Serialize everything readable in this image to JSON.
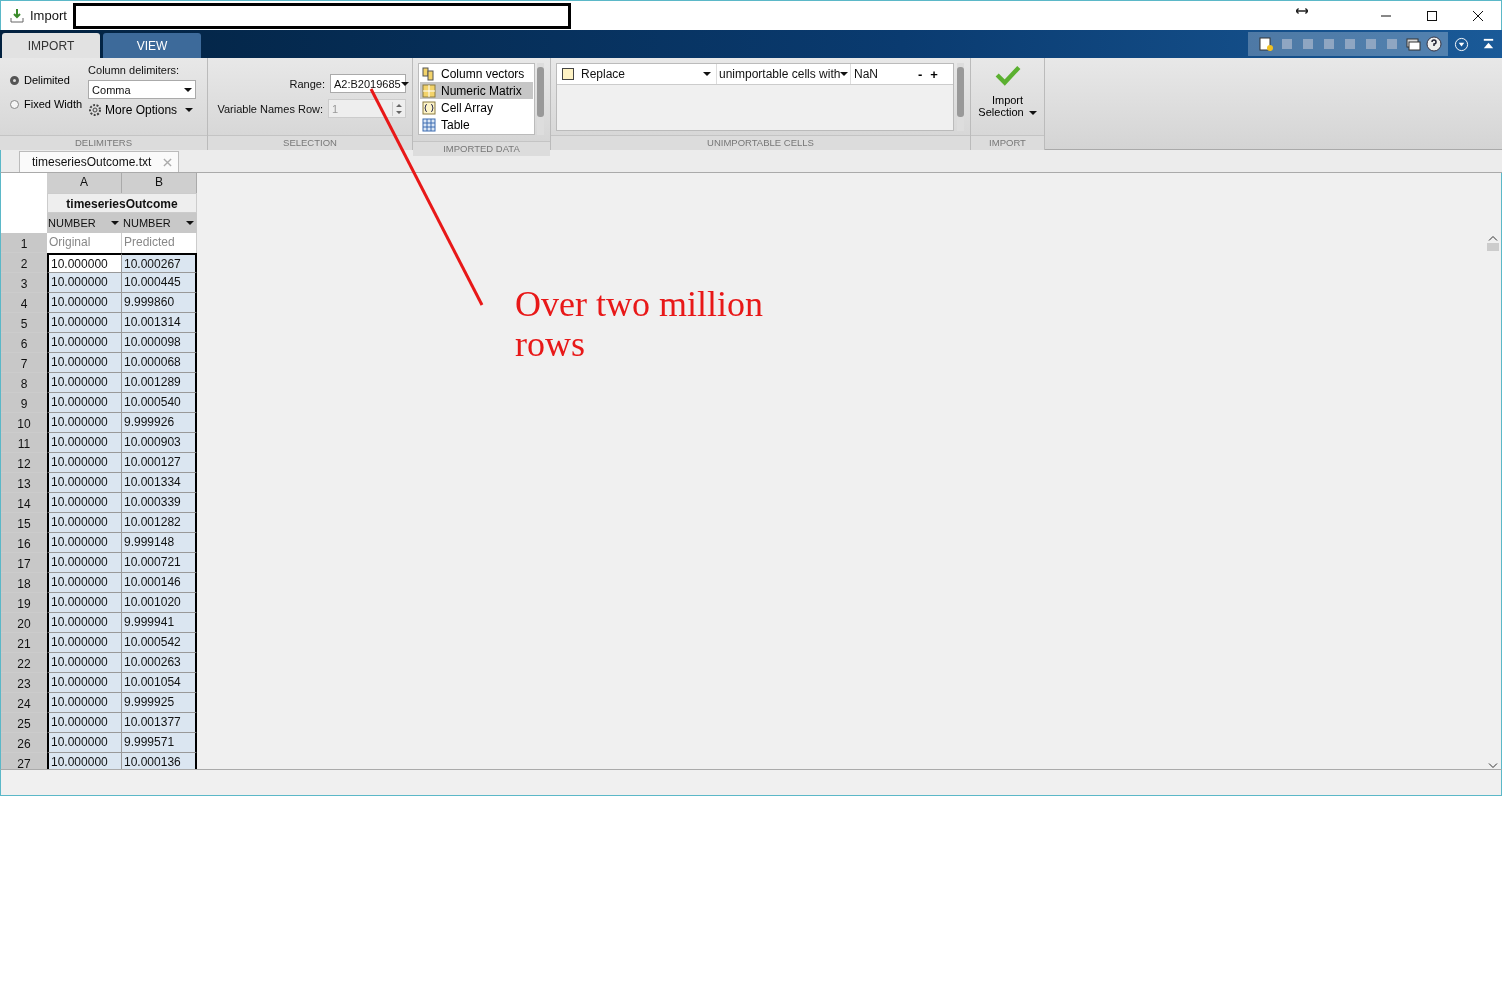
{
  "window": {
    "title": "Import"
  },
  "tabs": [
    {
      "label": "IMPORT",
      "selected": true
    },
    {
      "label": "VIEW",
      "selected": false
    }
  ],
  "delimiters": {
    "options": [
      {
        "label": "Delimited",
        "selected": true
      },
      {
        "label": "Fixed Width",
        "selected": false
      }
    ],
    "label": "Column delimiters:",
    "value": "Comma",
    "more_options": "More Options",
    "section": "DELIMITERS"
  },
  "selection": {
    "range_label": "Range:",
    "range_value": "A2:B2019685",
    "var_row_label": "Variable Names Row:",
    "var_row_value": "1",
    "section": "SELECTION"
  },
  "imported_data": {
    "items": [
      {
        "label": "Column vectors",
        "kind": "vectors",
        "selected": false
      },
      {
        "label": "Numeric Matrix",
        "kind": "matrix",
        "selected": true
      },
      {
        "label": "Cell Array",
        "kind": "cell",
        "selected": false
      },
      {
        "label": "Table",
        "kind": "table",
        "selected": false
      }
    ],
    "section": "IMPORTED DATA"
  },
  "unimportable": {
    "rules": [
      {
        "action": "Replace",
        "condition": "unimportable cells with",
        "value": "NaN",
        "color": "#fff3c4"
      }
    ],
    "minus": "-",
    "plus": "+",
    "section": "UNIMPORTABLE CELLS"
  },
  "import": {
    "button": "Import Selection",
    "section": "IMPORT"
  },
  "doc_tab": "timeseriesOutcome.txt",
  "table": {
    "columns": [
      "A",
      "B"
    ],
    "variable": "timeseriesOutcome",
    "types": [
      "NUMBER",
      "NUMBER"
    ],
    "header_row": {
      "n": "1",
      "cells": [
        "Original",
        "Predicted"
      ]
    },
    "rows": [
      {
        "n": "2",
        "cells": [
          "10.000000",
          "10.000267"
        ],
        "current": true
      },
      {
        "n": "3",
        "cells": [
          "10.000000",
          "10.000445"
        ],
        "current": false
      },
      {
        "n": "4",
        "cells": [
          "10.000000",
          "9.999860"
        ],
        "current": false
      },
      {
        "n": "5",
        "cells": [
          "10.000000",
          "10.001314"
        ],
        "current": false
      },
      {
        "n": "6",
        "cells": [
          "10.000000",
          "10.000098"
        ],
        "current": false
      },
      {
        "n": "7",
        "cells": [
          "10.000000",
          "10.000068"
        ],
        "current": false
      },
      {
        "n": "8",
        "cells": [
          "10.000000",
          "10.001289"
        ],
        "current": false
      },
      {
        "n": "9",
        "cells": [
          "10.000000",
          "10.000540"
        ],
        "current": false
      },
      {
        "n": "10",
        "cells": [
          "10.000000",
          "9.999926"
        ],
        "current": false
      },
      {
        "n": "11",
        "cells": [
          "10.000000",
          "10.000903"
        ],
        "current": false
      },
      {
        "n": "12",
        "cells": [
          "10.000000",
          "10.000127"
        ],
        "current": false
      },
      {
        "n": "13",
        "cells": [
          "10.000000",
          "10.001334"
        ],
        "current": false
      },
      {
        "n": "14",
        "cells": [
          "10.000000",
          "10.000339"
        ],
        "current": false
      },
      {
        "n": "15",
        "cells": [
          "10.000000",
          "10.001282"
        ],
        "current": false
      },
      {
        "n": "16",
        "cells": [
          "10.000000",
          "9.999148"
        ],
        "current": false
      },
      {
        "n": "17",
        "cells": [
          "10.000000",
          "10.000721"
        ],
        "current": false
      },
      {
        "n": "18",
        "cells": [
          "10.000000",
          "10.000146"
        ],
        "current": false
      },
      {
        "n": "19",
        "cells": [
          "10.000000",
          "10.001020"
        ],
        "current": false
      },
      {
        "n": "20",
        "cells": [
          "10.000000",
          "9.999941"
        ],
        "current": false
      },
      {
        "n": "21",
        "cells": [
          "10.000000",
          "10.000542"
        ],
        "current": false
      },
      {
        "n": "22",
        "cells": [
          "10.000000",
          "10.000263"
        ],
        "current": false
      },
      {
        "n": "23",
        "cells": [
          "10.000000",
          "10.001054"
        ],
        "current": false
      },
      {
        "n": "24",
        "cells": [
          "10.000000",
          "9.999925"
        ],
        "current": false
      },
      {
        "n": "25",
        "cells": [
          "10.000000",
          "10.001377"
        ],
        "current": false
      },
      {
        "n": "26",
        "cells": [
          "10.000000",
          "9.999571"
        ],
        "current": false
      },
      {
        "n": "27",
        "cells": [
          "10.000000",
          "10.000136"
        ],
        "current": false
      }
    ]
  },
  "annotation": {
    "text": "Over two million rows"
  }
}
